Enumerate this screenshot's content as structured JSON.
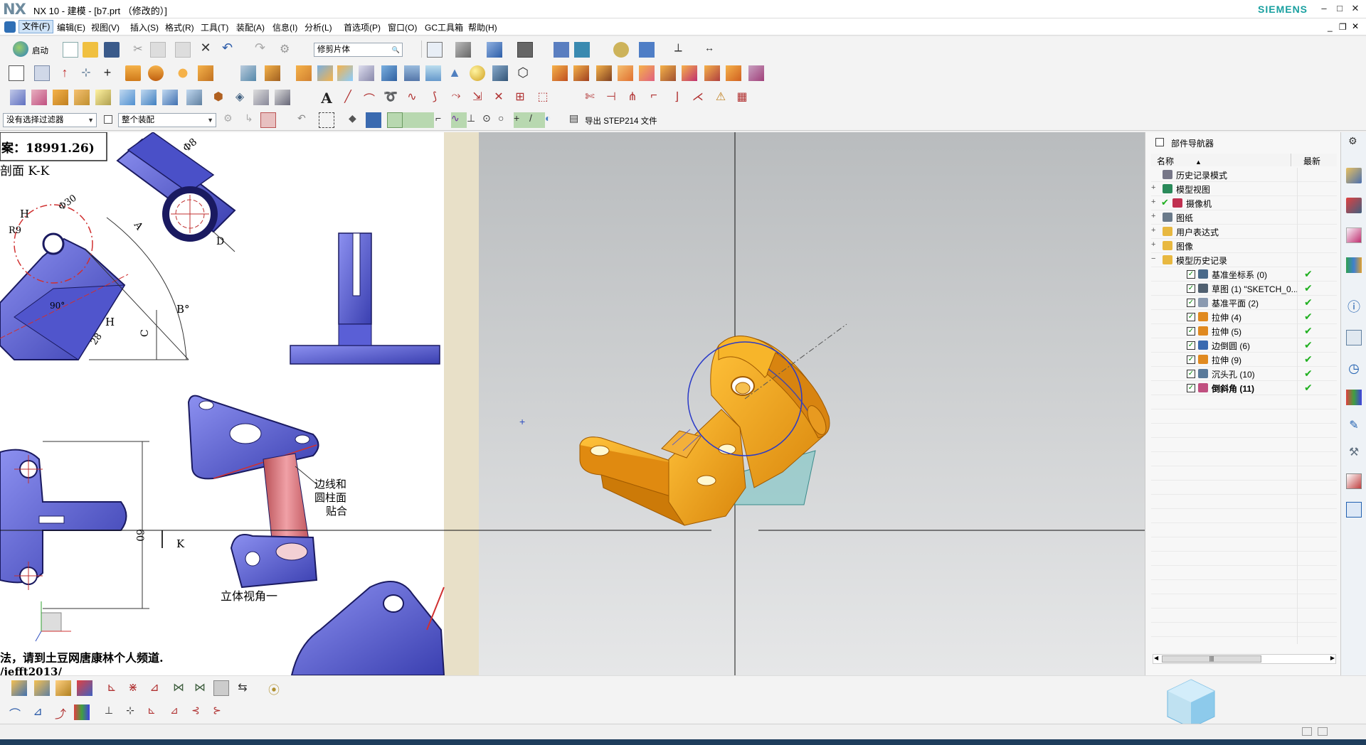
{
  "window": {
    "app_logo": "NX",
    "title": "NX 10 - 建模 - [b7.prt （修改的）]",
    "brand": "SIEMENS",
    "min": "–",
    "max": "□",
    "close": "✕"
  },
  "menu": [
    "文件(F)",
    "编辑(E)",
    "视图(V)",
    "插入(S)",
    "格式(R)",
    "工具(T)",
    "装配(A)",
    "信息(I)",
    "分析(L)",
    "首选项(P)",
    "窗口(O)",
    "GC工具箱",
    "帮助(H)"
  ],
  "toolbar": {
    "start_label": "启动",
    "trim_body_combo": "修剪片体",
    "selection_filter": "没有选择过滤器",
    "assembly_scope": "整个装配",
    "export_label": "导出 STEP214 文件"
  },
  "navigator": {
    "title": "部件导航器",
    "col_name": "名称",
    "col_latest": "最新",
    "items": [
      {
        "label": "历史记录模式",
        "indent": 0,
        "icon": "clock-icon",
        "expand": ""
      },
      {
        "label": "模型视图",
        "indent": 0,
        "icon": "views-icon",
        "expand": "+"
      },
      {
        "label": "摄像机",
        "indent": 0,
        "icon": "camera-icon",
        "expand": "+"
      },
      {
        "label": "图纸",
        "indent": 0,
        "icon": "drawing-icon",
        "expand": "+"
      },
      {
        "label": "用户表达式",
        "indent": 0,
        "icon": "folder-icon",
        "expand": "+"
      },
      {
        "label": "图像",
        "indent": 0,
        "icon": "folder-icon",
        "expand": "+"
      },
      {
        "label": "模型历史记录",
        "indent": 0,
        "icon": "folder-icon",
        "expand": "−"
      },
      {
        "label": "基准坐标系 (0)",
        "indent": 1,
        "icon": "datum-csys-icon",
        "checked": true,
        "latest": "✔"
      },
      {
        "label": "草图 (1) \"SKETCH_0...",
        "indent": 1,
        "icon": "sketch-icon",
        "checked": true,
        "latest": "✔"
      },
      {
        "label": "基准平面 (2)",
        "indent": 1,
        "icon": "datum-plane-icon",
        "checked": true,
        "latest": "✔"
      },
      {
        "label": "拉伸 (4)",
        "indent": 1,
        "icon": "extrude-icon",
        "checked": true,
        "latest": "✔"
      },
      {
        "label": "拉伸 (5)",
        "indent": 1,
        "icon": "extrude-icon",
        "checked": true,
        "latest": "✔"
      },
      {
        "label": "边倒圆 (6)",
        "indent": 1,
        "icon": "blend-icon",
        "checked": true,
        "latest": "✔"
      },
      {
        "label": "拉伸 (9)",
        "indent": 1,
        "icon": "extrude-icon",
        "checked": true,
        "latest": "✔"
      },
      {
        "label": "沉头孔 (10)",
        "indent": 1,
        "icon": "counterbore-icon",
        "checked": true,
        "latest": "✔"
      },
      {
        "label": "倒斜角 (11)",
        "indent": 1,
        "icon": "chamfer-icon",
        "checked": true,
        "latest": "✔",
        "bold": true
      }
    ]
  },
  "reference_image": {
    "line1": "案：18991.26)",
    "line2": "剖面 K-K",
    "annot": "边线和",
    "annot2": "圆柱面",
    "annot3": "贴合",
    "caption": "立体视角一",
    "footer1": "法，请到土豆网唐康林个人频道.",
    "footer2": "/jefft2013/",
    "dims": [
      "Φ8",
      "Φ30",
      "R9",
      "H",
      "90°",
      "28",
      "H",
      "B°",
      "C",
      "A",
      "D",
      "60",
      "K"
    ]
  },
  "colors": {
    "part_orange": "#f2a21a",
    "ref_blue": "#5a5fd6",
    "ref_pink": "#d9737a",
    "check_green": "#20b020",
    "siemens_teal": "#19a0a0"
  }
}
